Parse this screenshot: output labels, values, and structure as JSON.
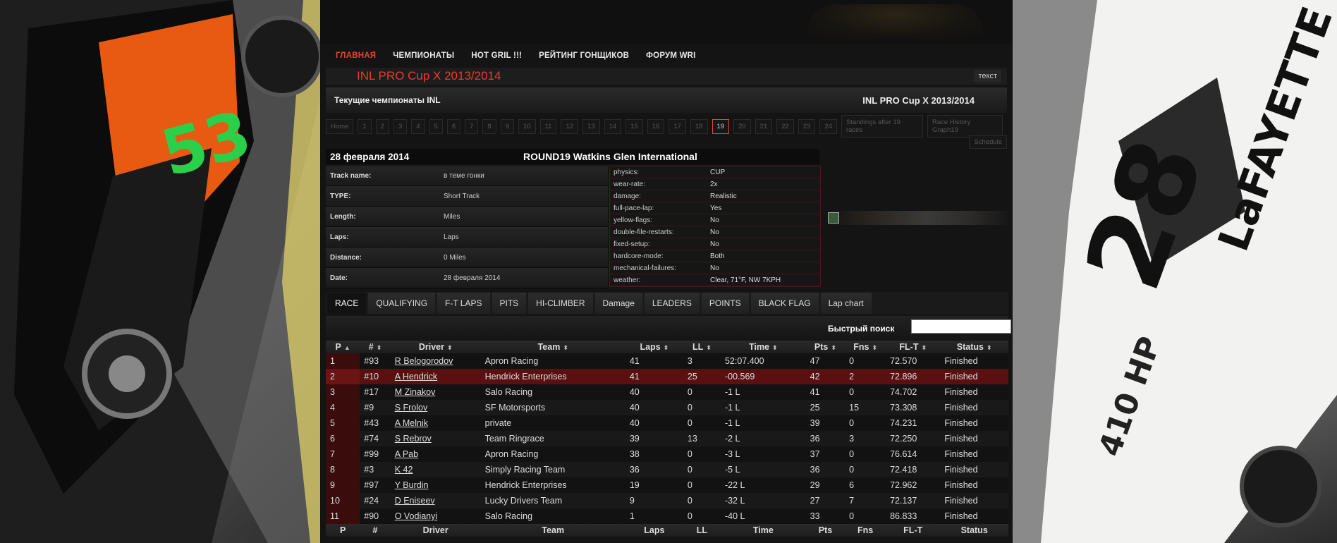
{
  "nav": {
    "items": [
      {
        "label": "ГЛАВНАЯ",
        "active": true
      },
      {
        "label": "ЧЕМПИОНАТЫ",
        "active": false
      },
      {
        "label": "HOT GRIL !!!",
        "active": false
      },
      {
        "label": "РЕЙТИНГ ГОНЩИКОВ",
        "active": false
      },
      {
        "label": "ФОРУМ WRI",
        "active": false
      }
    ]
  },
  "title_bar": {
    "title": "INL PRO Cup X 2013/2014",
    "right_label": "текст"
  },
  "champ_bar": {
    "left": "Текущие чемпионаты INL",
    "right": "INL PRO Cup X 2013/2014"
  },
  "pager": {
    "items": [
      "Home",
      "1",
      "2",
      "3",
      "4",
      "5",
      "6",
      "7",
      "8",
      "9",
      "10",
      "11",
      "12",
      "13",
      "14",
      "15",
      "16",
      "17",
      "18",
      "19",
      "20",
      "21",
      "22",
      "23",
      "24",
      "Standings after 19 races",
      "Race History Graph19"
    ],
    "selected": "19",
    "schedule": "Schedule"
  },
  "race_info": {
    "date": "28 февраля 2014",
    "round": "ROUND19 Watkins Glen International",
    "track": [
      {
        "key": "Track name:",
        "value": "в теме гонки"
      },
      {
        "key": "TYPE:",
        "value": "Short Track"
      },
      {
        "key": "Length:",
        "value": "Miles"
      },
      {
        "key": "Laps:",
        "value": "Laps"
      },
      {
        "key": "Distance:",
        "value": "0 Miles"
      },
      {
        "key": "Date:",
        "value": "28 февраля 2014"
      }
    ],
    "config": [
      {
        "key": "physics:",
        "value": "CUP"
      },
      {
        "key": "wear-rate:",
        "value": "2x"
      },
      {
        "key": "damage:",
        "value": "Realistic"
      },
      {
        "key": "full-pace-lap:",
        "value": "Yes"
      },
      {
        "key": "yellow-flags:",
        "value": "No"
      },
      {
        "key": "double-file-restarts:",
        "value": "No"
      },
      {
        "key": "fixed-setup:",
        "value": "No"
      },
      {
        "key": "hardcore-mode:",
        "value": "Both"
      },
      {
        "key": "mechanical-failures:",
        "value": "No"
      },
      {
        "key": "weather:",
        "value": "Clear, 71°F, NW 7KPH"
      }
    ]
  },
  "tabs": {
    "items": [
      "RACE",
      "QUALIFYING",
      "F-T LAPS",
      "PITS",
      "HI-CLIMBER",
      "Damage",
      "LEADERS",
      "POINTS",
      "BLACK FLAG",
      "Lap chart"
    ],
    "active": "RACE"
  },
  "search": {
    "label": "Быстрый поиск",
    "value": ""
  },
  "results": {
    "headers": [
      "P",
      "#",
      "Driver",
      "Team",
      "Laps",
      "LL",
      "Time",
      "Pts",
      "Fns",
      "FL-T",
      "Status"
    ],
    "rows": [
      [
        "1",
        "#93",
        "R Belogorodov",
        "Apron Racing",
        "41",
        "3",
        "52:07.400",
        "47",
        "0",
        "72.570",
        "Finished"
      ],
      [
        "2",
        "#10",
        "A Hendrick",
        "Hendrick Enterprises",
        "41",
        "25",
        "-00.569",
        "42",
        "2",
        "72.896",
        "Finished"
      ],
      [
        "3",
        "#17",
        "M Zinakov",
        "Salo Racing",
        "40",
        "0",
        "-1 L",
        "41",
        "0",
        "74.702",
        "Finished"
      ],
      [
        "4",
        "#9",
        "S Frolov",
        "SF Motorsports",
        "40",
        "0",
        "-1 L",
        "25",
        "15",
        "73.308",
        "Finished"
      ],
      [
        "5",
        "#43",
        "A Melnik",
        "private",
        "40",
        "0",
        "-1 L",
        "39",
        "0",
        "74.231",
        "Finished"
      ],
      [
        "6",
        "#74",
        "S Rebrov",
        "Team Ringrace",
        "39",
        "13",
        "-2 L",
        "36",
        "3",
        "72.250",
        "Finished"
      ],
      [
        "7",
        "#99",
        "A Pab",
        "Apron Racing",
        "38",
        "0",
        "-3 L",
        "37",
        "0",
        "76.614",
        "Finished"
      ],
      [
        "8",
        "#3",
        "K 42",
        "Simply Racing Team",
        "36",
        "0",
        "-5 L",
        "36",
        "0",
        "72.418",
        "Finished"
      ],
      [
        "9",
        "#97",
        "Y Burdin",
        "Hendrick Enterprises",
        "19",
        "0",
        "-22 L",
        "29",
        "6",
        "72.962",
        "Finished"
      ],
      [
        "10",
        "#24",
        "D Eniseev",
        "Lucky Drivers Team",
        "9",
        "0",
        "-32 L",
        "27",
        "7",
        "72.137",
        "Finished"
      ],
      [
        "11",
        "#90",
        "O Vodianyi",
        "Salo Racing",
        "1",
        "0",
        "-40 L",
        "33",
        "0",
        "86.833",
        "Finished"
      ]
    ],
    "highlight_row": 1
  },
  "colors": {
    "accent": "#e8442a",
    "highlight_row": "#5a1010"
  }
}
